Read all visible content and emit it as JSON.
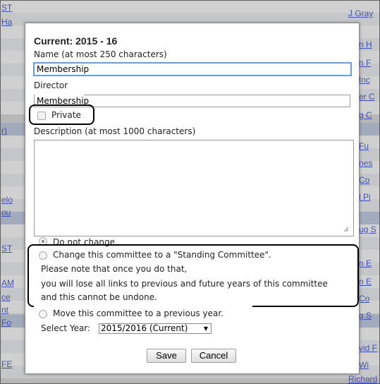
{
  "background": {
    "left_cells": [
      "ST",
      "Ha",
      "",
      "",
      "",
      "",
      "r)",
      "",
      "",
      "",
      "elo",
      "ou",
      "ST",
      "",
      "AM",
      "ce",
      "nt",
      "Fo",
      "",
      "FE"
    ],
    "right_cells": [
      "J Gray",
      "n H",
      "n F",
      "Inc",
      "er C",
      "g C",
      "",
      "Fu",
      "nes",
      "Co",
      "l Pi",
      "",
      "ug S",
      "",
      "n E",
      "n E",
      "Co",
      "g S",
      "",
      "vid F",
      "Wi",
      "Richard"
    ]
  },
  "dialog": {
    "current_label": "Current: 2015 - 16",
    "name_label": "Name (at most 250 characters)",
    "name_value": "Membership",
    "director_label": "Director",
    "director_value": "Membership",
    "private_label": "Private",
    "description_label": "Description (at most 1000 characters)",
    "description_value": "",
    "options": {
      "no_change": "Do not change",
      "standing": "Change this committee to a \"Standing Committee\".",
      "note_line1": "Please note that once you do that,",
      "note_line2": "you will lose all links to previous and future years of this committee",
      "note_line3": "and this cannot be undone.",
      "move": "Move this committee to a previous year.",
      "select_year_label": "Select Year:",
      "select_year_value": "2015/2016 (Current)"
    },
    "save_label": "Save",
    "cancel_label": "Cancel"
  }
}
